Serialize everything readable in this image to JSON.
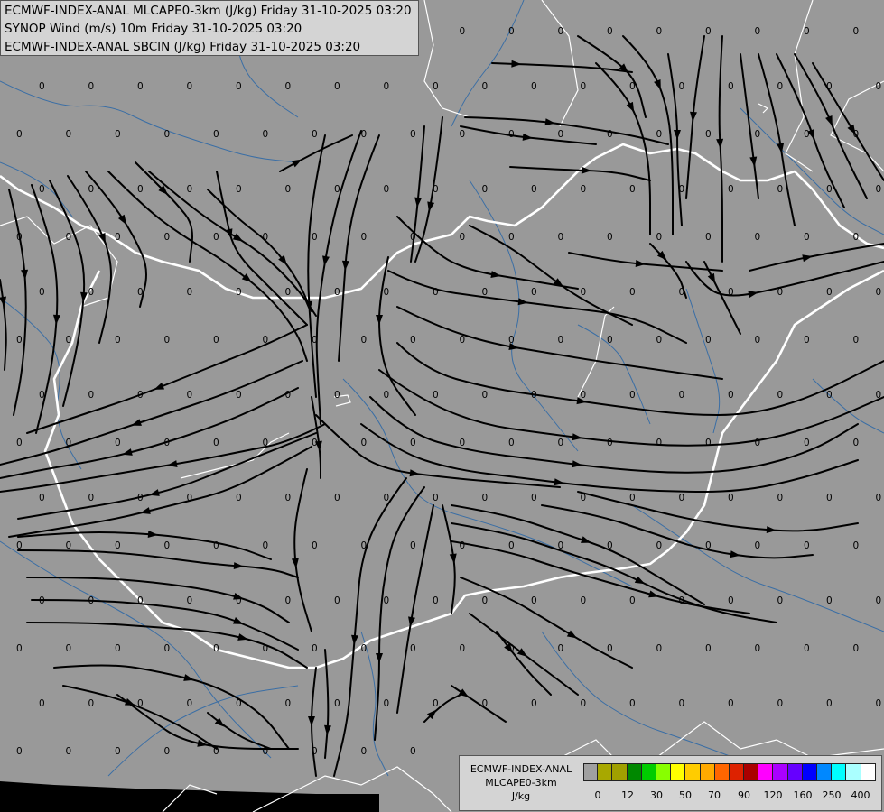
{
  "header": {
    "line1": "ECMWF-INDEX-ANAL MLCAPE0-3km (J/kg) Friday 31-10-2025 03:20",
    "line2": "SYNOP Wind (m/s) 10m Friday 31-10-2025 03:20",
    "line3": "ECMWF-INDEX-ANAL SBCIN (J/kg) Friday 31-10-2025 03:20"
  },
  "legend": {
    "model": "ECMWF-INDEX-ANAL",
    "parameter": "MLCAPE0-3km",
    "unit": "J/kg",
    "colors": [
      "#a0a0a0",
      "#a8a800",
      "#a0a000",
      "#008800",
      "#00cc00",
      "#88ff00",
      "#ffff00",
      "#ffcc00",
      "#ffaa00",
      "#ff6600",
      "#dd2200",
      "#aa0000",
      "#ff00ff",
      "#aa00ff",
      "#6600ff",
      "#0000ff",
      "#0088ff",
      "#00ffff",
      "#aaffff",
      "#ffffff"
    ],
    "ticks": [
      "0",
      "12",
      "30",
      "50",
      "70",
      "90",
      "120",
      "160",
      "250",
      "400"
    ]
  },
  "map": {
    "field_value": "0",
    "background_color": "#999999",
    "border_color": "#ffffff",
    "river_color": "#3a6ea5",
    "streamline_color": "#000000"
  }
}
